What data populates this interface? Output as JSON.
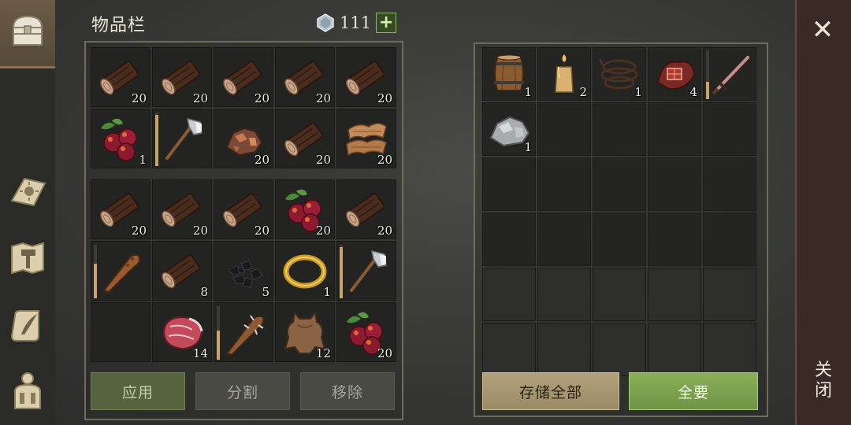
{
  "inventory": {
    "title": "物品栏",
    "gems": "111",
    "add_label": "+",
    "rows": [
      [
        {
          "name": "log-icon",
          "qty": "20"
        },
        {
          "name": "log-icon",
          "qty": "20"
        },
        {
          "name": "log-icon",
          "qty": "20"
        },
        {
          "name": "log-icon",
          "qty": "20"
        },
        {
          "name": "log-icon",
          "qty": "20"
        }
      ],
      [
        {
          "name": "berries-icon",
          "qty": "1"
        },
        {
          "name": "hatchet-icon",
          "qty": "",
          "durability": 0.95
        },
        {
          "name": "copper-ore-icon",
          "qty": "20"
        },
        {
          "name": "log-icon",
          "qty": "20"
        },
        {
          "name": "leather-scraps-icon",
          "qty": "20"
        }
      ],
      [
        {
          "name": "log-icon",
          "qty": "20"
        },
        {
          "name": "log-icon",
          "qty": "20"
        },
        {
          "name": "log-icon",
          "qty": "20"
        },
        {
          "name": "berries-icon",
          "qty": "20"
        },
        {
          "name": "log-icon",
          "qty": "20"
        }
      ],
      [
        {
          "name": "club-icon",
          "qty": "",
          "durability": 0.65
        },
        {
          "name": "log-icon",
          "qty": "8"
        },
        {
          "name": "coal-icon",
          "qty": "5"
        },
        {
          "name": "gold-ring-icon",
          "qty": "1"
        },
        {
          "name": "hatchet-icon",
          "qty": "",
          "durability": 0.95
        }
      ],
      [
        {
          "name": "",
          "qty": ""
        },
        {
          "name": "raw-meat-icon",
          "qty": "14"
        },
        {
          "name": "spiked-club-icon",
          "qty": "",
          "durability": 0.55
        },
        {
          "name": "hide-icon",
          "qty": "12"
        },
        {
          "name": "berries-icon",
          "qty": "20"
        }
      ]
    ],
    "buttons": {
      "apply": "应用",
      "split": "分割",
      "remove": "移除"
    }
  },
  "storage": {
    "rows": [
      [
        {
          "name": "barrel-icon",
          "qty": "1"
        },
        {
          "name": "candle-icon",
          "qty": "2"
        },
        {
          "name": "rope-icon",
          "qty": "1"
        },
        {
          "name": "bandage-icon",
          "qty": "4"
        },
        {
          "name": "sword-icon",
          "qty": "",
          "durability": 0.35
        }
      ],
      [
        {
          "name": "stone-icon",
          "qty": "1"
        },
        {
          "name": "",
          "qty": ""
        },
        {
          "name": "",
          "qty": ""
        },
        {
          "name": "",
          "qty": ""
        },
        {
          "name": "",
          "qty": ""
        }
      ]
    ],
    "empty_rows": 4,
    "buttons": {
      "store_all": "存储全部",
      "take_all": "全要"
    }
  },
  "close": {
    "icon": "close-icon",
    "label_line1": "关",
    "label_line2": "闭"
  },
  "colors": {
    "accent_green": "#8ab05a",
    "panel_border": "#6f6b61",
    "close_bar": "#3a2a26"
  }
}
